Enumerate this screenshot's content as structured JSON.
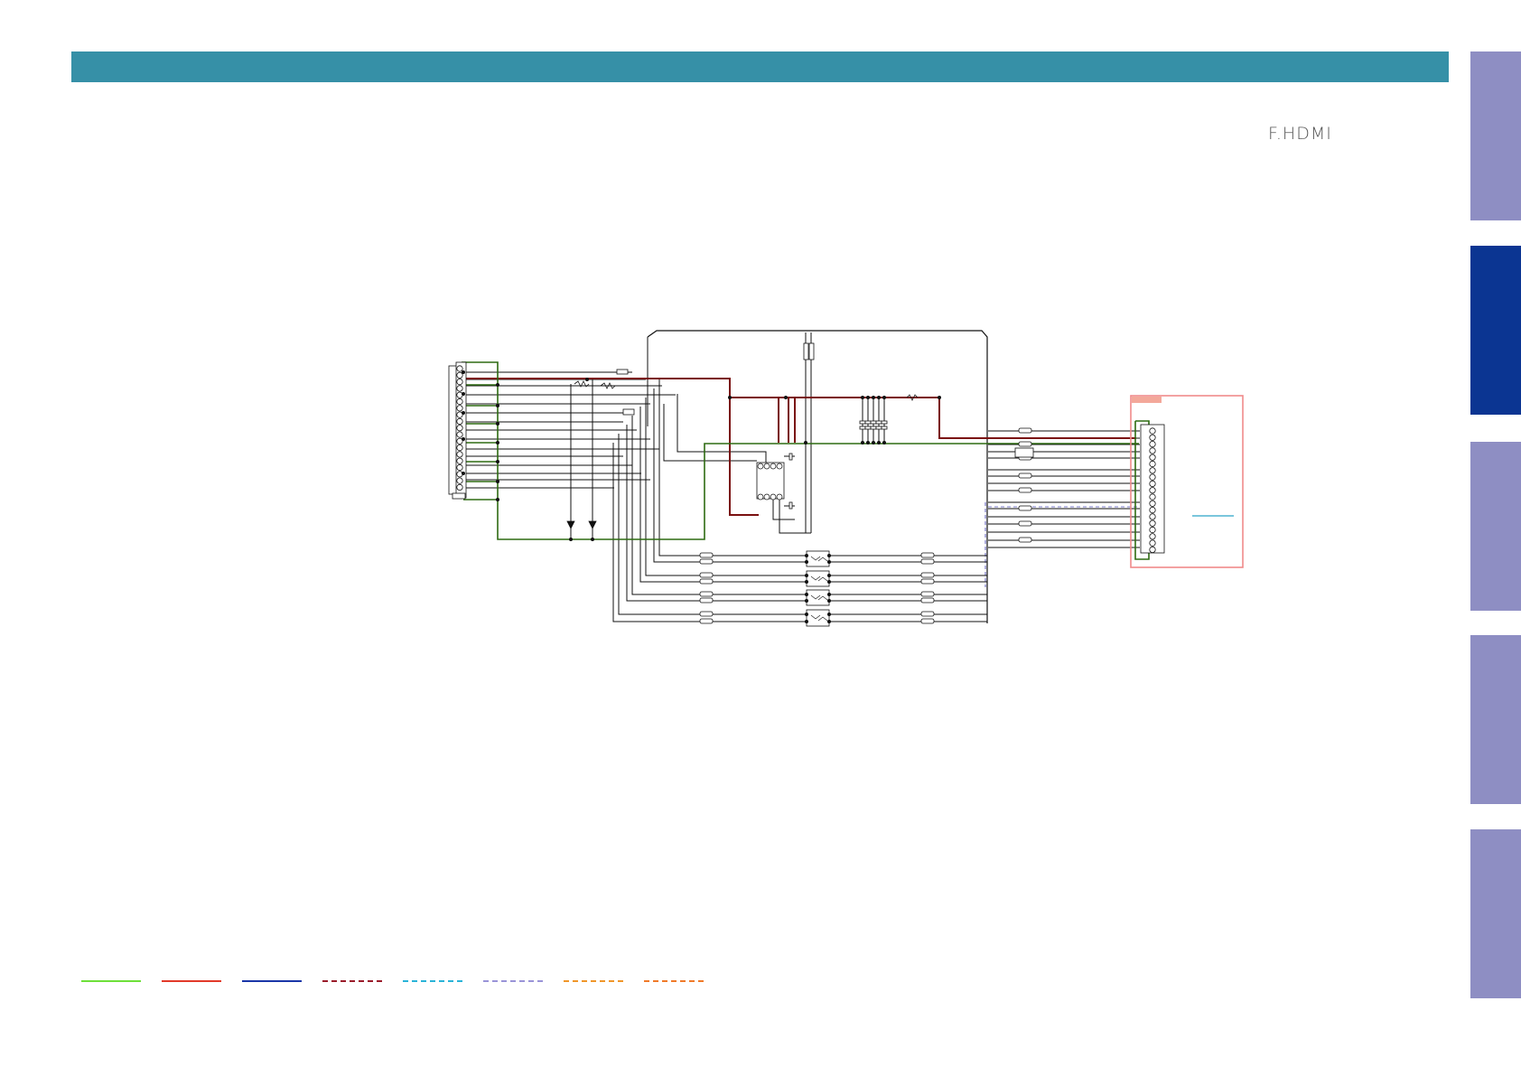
{
  "header": {
    "band_color": "#3690a7"
  },
  "page": {
    "section_title": "F.HDMI"
  },
  "side_tabs": [
    {
      "state": "inactive",
      "color": "#8e8ec3"
    },
    {
      "state": "active",
      "color": "#0b3592"
    },
    {
      "state": "inactive",
      "color": "#8e8ec3"
    },
    {
      "state": "inactive",
      "color": "#8e8ec3"
    },
    {
      "state": "inactive",
      "color": "#8e8ec3"
    }
  ],
  "schematic": {
    "colors": {
      "wire": "#111111",
      "power_line": "#7a1010",
      "ground_line": "#2e6b12",
      "dashed_bus": "#7a78c8",
      "highlight_box": "#f08a8a",
      "highlight_tag": "#f3a89a",
      "annotation_line": "#2aa3c8"
    }
  },
  "legend": [
    {
      "style": "solid",
      "color": "#6ee03a"
    },
    {
      "style": "solid",
      "color": "#e23a2a"
    },
    {
      "style": "solid",
      "color": "#1a36a8"
    },
    {
      "style": "dashed",
      "color": "#9a1a2a"
    },
    {
      "style": "dashed",
      "color": "#2ab3d8"
    },
    {
      "style": "dashed",
      "color": "#9a94d8"
    },
    {
      "style": "dashed",
      "color": "#f0962a"
    },
    {
      "style": "dashed",
      "color": "#f07a2a"
    }
  ]
}
